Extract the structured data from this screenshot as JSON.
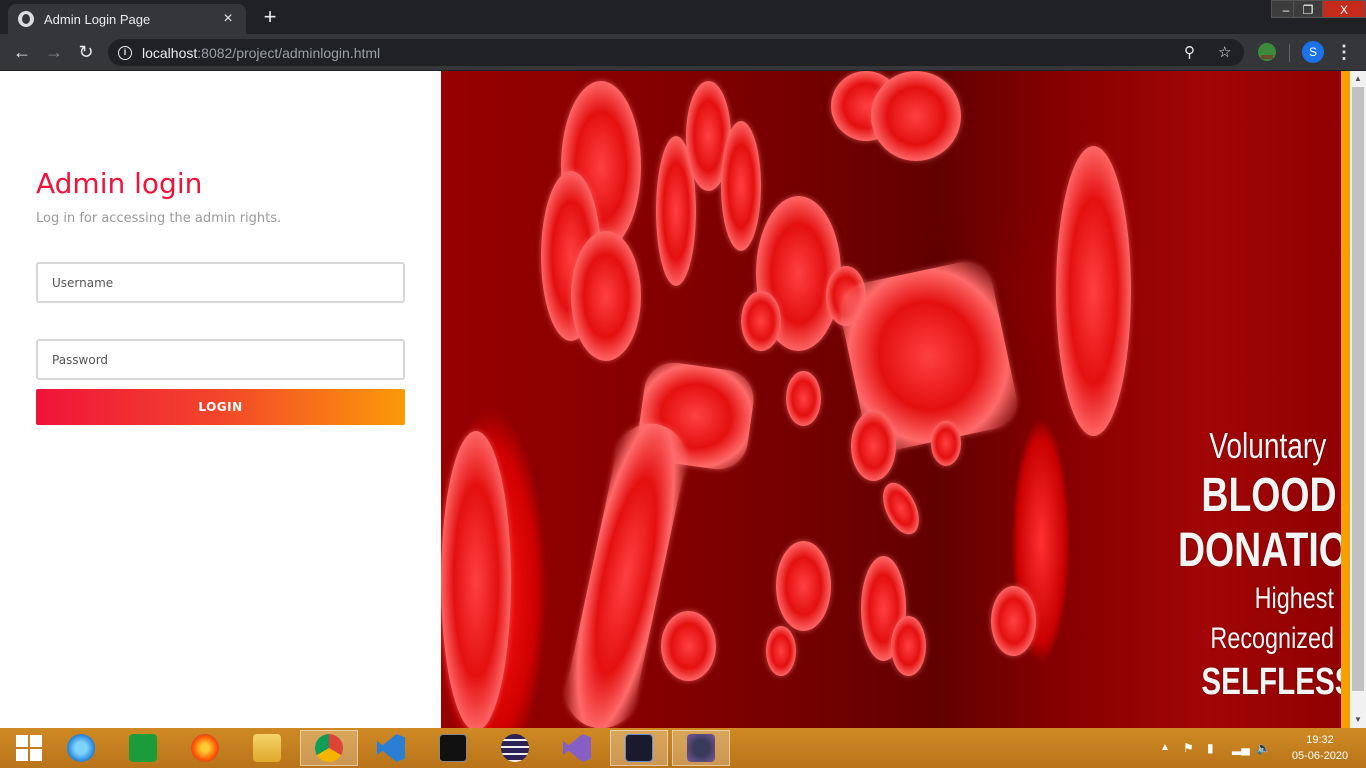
{
  "browser": {
    "tab_title": "Admin Login Page",
    "tab_close": "×",
    "new_tab": "+",
    "url_host": "localhost",
    "url_rest": ":8082/project/adminlogin.html",
    "profile_initial": "S",
    "window_controls": {
      "minimize": "–",
      "restore": "❐",
      "close": "X"
    }
  },
  "login": {
    "title": "Admin login",
    "subtitle": "Log in for accessing the admin rights.",
    "username_placeholder": "Username",
    "password_placeholder": "Password",
    "button_label": "LOGIN",
    "colors": {
      "accent": "#f0133b",
      "gradient_end": "#fb9a08"
    }
  },
  "hero": {
    "line1": "Voluntary",
    "line2": "BLOOD",
    "line3": "DONATION",
    "line4": "Highest Recognized",
    "line5": "SELFLESS VALOUR!"
  },
  "taskbar": {
    "items": [
      "windows-start",
      "internet-explorer",
      "store",
      "firefox",
      "file-explorer",
      "chrome",
      "vscode",
      "cmd",
      "eclipse",
      "visual-studio",
      "mysql",
      "java-ee-ide"
    ],
    "clock_time": "19:32",
    "clock_date": "05-06-2020"
  }
}
